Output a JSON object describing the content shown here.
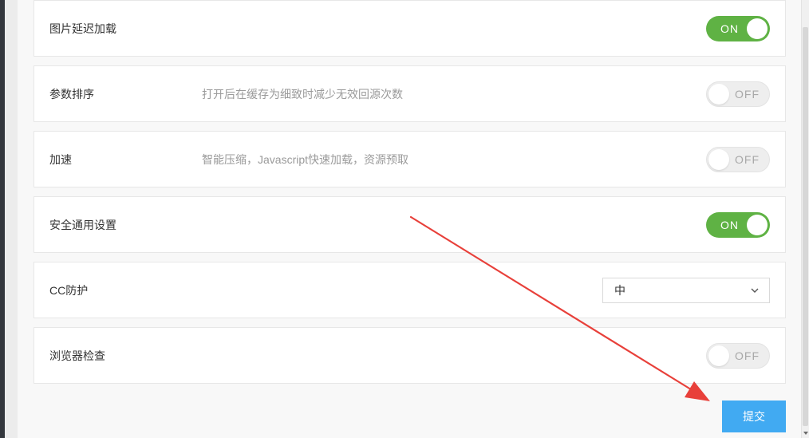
{
  "settings": [
    {
      "label": "图片延迟加载",
      "description": "",
      "control": "toggle",
      "state": "ON"
    },
    {
      "label": "参数排序",
      "description": "打开后在缓存为细致时减少无效回源次数",
      "control": "toggle",
      "state": "OFF"
    },
    {
      "label": "加速",
      "description": "智能压缩，Javascript快速加载，资源预取",
      "control": "toggle",
      "state": "OFF"
    },
    {
      "label": "安全通用设置",
      "description": "",
      "control": "toggle",
      "state": "ON"
    },
    {
      "label": "CC防护",
      "description": "",
      "control": "select",
      "selected": "中"
    },
    {
      "label": "浏览器检查",
      "description": "",
      "control": "toggle",
      "state": "OFF"
    }
  ],
  "submit_label": "提交",
  "colors": {
    "toggle_on": "#5fb244",
    "toggle_off": "#eeeeee",
    "submit_button": "#41aaf2",
    "annotation_arrow": "#e8403a"
  },
  "icons": {
    "select_chevron": "chevron-down-icon",
    "annotation": "red-arrow-icon"
  }
}
